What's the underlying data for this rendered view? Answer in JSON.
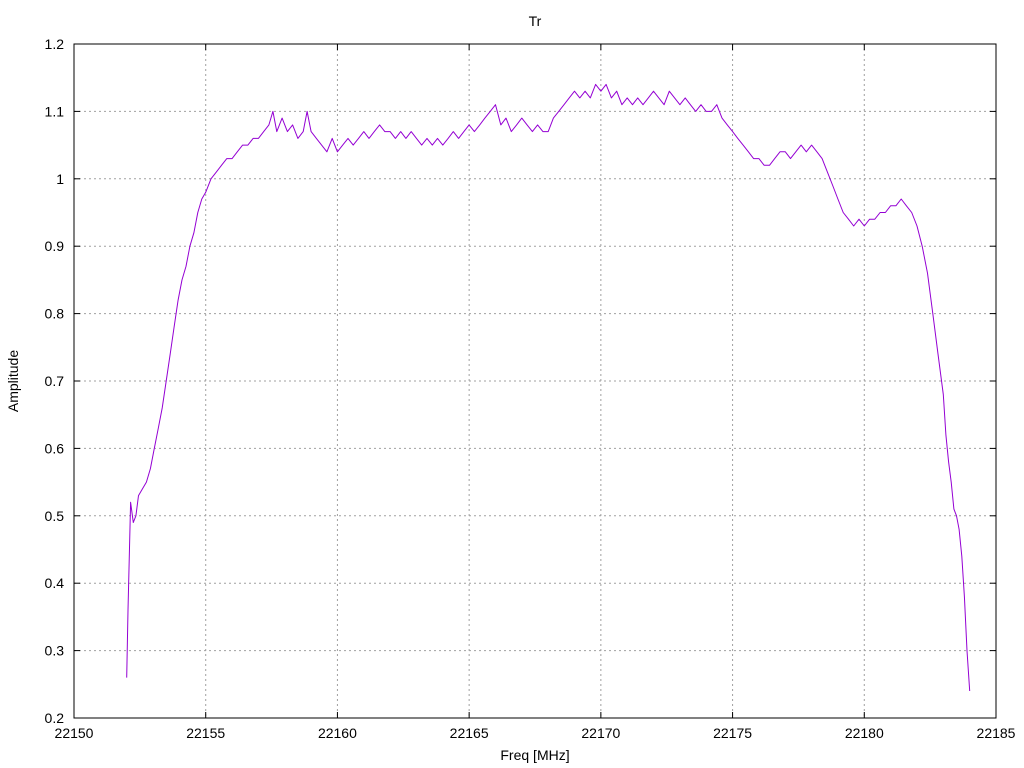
{
  "chart_data": {
    "type": "line",
    "title": "Tr",
    "xlabel": "Freq [MHz]",
    "ylabel": "Amplitude",
    "xlim": [
      22150,
      22185
    ],
    "ylim": [
      0.2,
      1.2
    ],
    "xticks": [
      22150,
      22155,
      22160,
      22165,
      22170,
      22175,
      22180,
      22185
    ],
    "yticks": [
      0.2,
      0.3,
      0.4,
      0.5,
      0.6,
      0.7,
      0.8,
      0.9,
      1,
      1.1,
      1.2
    ],
    "xtick_labels": [
      "22150",
      "22155",
      "22160",
      "22165",
      "22170",
      "22175",
      "22180",
      "22185"
    ],
    "ytick_labels": [
      "0.2",
      "0.3",
      "0.4",
      "0.5",
      "0.6",
      "0.7",
      "0.8",
      "0.9",
      "1",
      "1.1",
      "1.2"
    ],
    "grid": true,
    "series": [
      {
        "color": "#9400d3",
        "x": [
          22152.0,
          22152.05,
          22152.15,
          22152.25,
          22152.35,
          22152.45,
          22152.6,
          22152.75,
          22152.9,
          22153.05,
          22153.2,
          22153.35,
          22153.5,
          22153.65,
          22153.8,
          22153.95,
          22154.1,
          22154.25,
          22154.4,
          22154.55,
          22154.7,
          22154.85,
          22155.0,
          22155.2,
          22155.4,
          22155.6,
          22155.8,
          22156.0,
          22156.2,
          22156.4,
          22156.6,
          22156.8,
          22157.0,
          22157.2,
          22157.4,
          22157.55,
          22157.7,
          22157.9,
          22158.1,
          22158.3,
          22158.5,
          22158.7,
          22158.85,
          22159.0,
          22159.2,
          22159.4,
          22159.6,
          22159.8,
          22160.0,
          22160.2,
          22160.4,
          22160.6,
          22160.8,
          22161.0,
          22161.2,
          22161.4,
          22161.6,
          22161.8,
          22162.0,
          22162.2,
          22162.4,
          22162.6,
          22162.8,
          22163.0,
          22163.2,
          22163.4,
          22163.6,
          22163.8,
          22164.0,
          22164.2,
          22164.4,
          22164.6,
          22164.8,
          22165.0,
          22165.2,
          22165.4,
          22165.6,
          22165.8,
          22166.0,
          22166.2,
          22166.4,
          22166.6,
          22166.8,
          22167.0,
          22167.2,
          22167.4,
          22167.6,
          22167.8,
          22168.0,
          22168.2,
          22168.4,
          22168.6,
          22168.8,
          22169.0,
          22169.2,
          22169.4,
          22169.6,
          22169.8,
          22170.0,
          22170.2,
          22170.4,
          22170.6,
          22170.8,
          22171.0,
          22171.2,
          22171.4,
          22171.6,
          22171.8,
          22172.0,
          22172.2,
          22172.4,
          22172.6,
          22172.8,
          22173.0,
          22173.2,
          22173.4,
          22173.6,
          22173.8,
          22174.0,
          22174.2,
          22174.4,
          22174.6,
          22174.8,
          22175.0,
          22175.2,
          22175.4,
          22175.6,
          22175.8,
          22176.0,
          22176.2,
          22176.4,
          22176.6,
          22176.8,
          22177.0,
          22177.2,
          22177.4,
          22177.6,
          22177.8,
          22178.0,
          22178.2,
          22178.4,
          22178.6,
          22178.8,
          22179.0,
          22179.2,
          22179.4,
          22179.6,
          22179.8,
          22180.0,
          22180.2,
          22180.4,
          22180.6,
          22180.8,
          22181.0,
          22181.2,
          22181.4,
          22181.6,
          22181.8,
          22182.0,
          22182.2,
          22182.4,
          22182.6,
          22182.8,
          22183.0,
          22183.1,
          22183.2,
          22183.3,
          22183.4,
          22183.5,
          22183.6,
          22183.7,
          22183.8,
          22183.9,
          22184.0
        ],
        "y": [
          0.26,
          0.36,
          0.52,
          0.49,
          0.5,
          0.53,
          0.54,
          0.55,
          0.57,
          0.6,
          0.63,
          0.66,
          0.7,
          0.74,
          0.78,
          0.82,
          0.85,
          0.87,
          0.9,
          0.92,
          0.95,
          0.97,
          0.98,
          1.0,
          1.01,
          1.02,
          1.03,
          1.03,
          1.04,
          1.05,
          1.05,
          1.06,
          1.06,
          1.07,
          1.08,
          1.1,
          1.07,
          1.09,
          1.07,
          1.08,
          1.06,
          1.07,
          1.1,
          1.07,
          1.06,
          1.05,
          1.04,
          1.06,
          1.04,
          1.05,
          1.06,
          1.05,
          1.06,
          1.07,
          1.06,
          1.07,
          1.08,
          1.07,
          1.07,
          1.06,
          1.07,
          1.06,
          1.07,
          1.06,
          1.05,
          1.06,
          1.05,
          1.06,
          1.05,
          1.06,
          1.07,
          1.06,
          1.07,
          1.08,
          1.07,
          1.08,
          1.09,
          1.1,
          1.11,
          1.08,
          1.09,
          1.07,
          1.08,
          1.09,
          1.08,
          1.07,
          1.08,
          1.07,
          1.07,
          1.09,
          1.1,
          1.11,
          1.12,
          1.13,
          1.12,
          1.13,
          1.12,
          1.14,
          1.13,
          1.14,
          1.12,
          1.13,
          1.11,
          1.12,
          1.11,
          1.12,
          1.11,
          1.12,
          1.13,
          1.12,
          1.11,
          1.13,
          1.12,
          1.11,
          1.12,
          1.11,
          1.1,
          1.11,
          1.1,
          1.1,
          1.11,
          1.09,
          1.08,
          1.07,
          1.06,
          1.05,
          1.04,
          1.03,
          1.03,
          1.02,
          1.02,
          1.03,
          1.04,
          1.04,
          1.03,
          1.04,
          1.05,
          1.04,
          1.05,
          1.04,
          1.03,
          1.01,
          0.99,
          0.97,
          0.95,
          0.94,
          0.93,
          0.94,
          0.93,
          0.94,
          0.94,
          0.95,
          0.95,
          0.96,
          0.96,
          0.97,
          0.96,
          0.95,
          0.93,
          0.9,
          0.86,
          0.8,
          0.74,
          0.68,
          0.62,
          0.58,
          0.55,
          0.51,
          0.5,
          0.48,
          0.44,
          0.38,
          0.3,
          0.24
        ]
      }
    ]
  }
}
